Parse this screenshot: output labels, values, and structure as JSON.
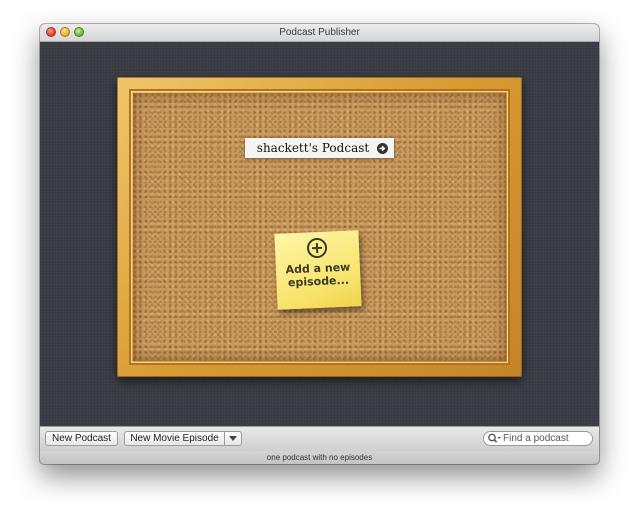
{
  "window": {
    "title": "Podcast Publisher"
  },
  "board": {
    "podcast_name": "shackett's Podcast",
    "sticky_note": "Add a new\nepisode..."
  },
  "toolbar": {
    "new_podcast_label": "New Podcast",
    "new_movie_episode_label": "New Movie Episode",
    "search_placeholder": "Find a podcast",
    "search_value": ""
  },
  "status": {
    "text": "one podcast with no episodes"
  },
  "icons": {
    "arrow": "right-arrow-circle-icon",
    "plus": "plus-circle-icon",
    "search": "magnifier-icon",
    "dropdown": "triangle-down-icon"
  },
  "colors": {
    "content_bg": "#3a3d44",
    "cork": "#c99a5e",
    "frame": "#d99a32",
    "sticky": "#f8e36a"
  }
}
